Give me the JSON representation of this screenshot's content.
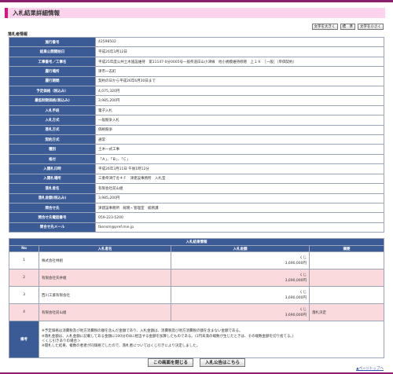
{
  "page": {
    "title": "入札結果詳細情報"
  },
  "font_buttons": {
    "large": "文字を大きく",
    "standard": "標　準",
    "small": "文字を小さく"
  },
  "section": {
    "label": "落札者情報"
  },
  "details": [
    {
      "label": "施行番号",
      "value": "42598502"
    },
    {
      "label": "結果公開開始日",
      "value": "平成26年3月12日"
    },
    {
      "label": "工事番号／工事名",
      "value": "平成25年度公共土木施設維持　第11147-0分0005号一般県道白山小津線　他小規模維持修繕　上１９　［一般］（単価契約）"
    },
    {
      "label": "履行場所",
      "value": "津市一志町"
    },
    {
      "label": "履行期間",
      "value": "契約の日から平成26年6月30日まで"
    },
    {
      "label": "予定価格（税込み）",
      "value": "4,075,320円"
    },
    {
      "label": "最低制限価格(税込み)",
      "value": "3,985,200円"
    },
    {
      "label": "入札手段",
      "value": "電子入札"
    },
    {
      "label": "入札方式",
      "value": "一般競争入札"
    },
    {
      "label": "落札方式",
      "value": "価格競争"
    },
    {
      "label": "契約方式",
      "value": "通常"
    },
    {
      "label": "種別",
      "value": "土木一式工事"
    },
    {
      "label": "格付",
      "value": "「Ａ」、「Ｂ」、「Ｃ」"
    },
    {
      "label": "入開札日時",
      "value": "平成26年3月11日 午後1時12分"
    },
    {
      "label": "入開札場所",
      "value": "三重県津庁舎４Ｆ　津建設事務所　入札室"
    },
    {
      "label": "落札者名",
      "value": "有限会社前山組"
    },
    {
      "label": "落札金額(税込み)",
      "value": "3,985,200円"
    },
    {
      "label": "問合せ先",
      "value": "津建設事務所　総務・管理室　総務課"
    },
    {
      "label": "問合せ先電話番号",
      "value": "059-223-5200"
    },
    {
      "label": "問合せ先メール",
      "value": "tkensm@pref.mie.jp"
    }
  ],
  "results": {
    "caption": "入札結果情報",
    "headers": {
      "no": "No",
      "name": "入札者名",
      "amount": "入札金額",
      "remarks": "摘要"
    },
    "rows": [
      {
        "no": "1",
        "name": "株式会社林組",
        "amount1": "くじ",
        "amount2": "3,690,000円",
        "remark": ""
      },
      {
        "no": "2",
        "name": "有限会社矢井組",
        "amount1": "くじ",
        "amount2": "3,690,000円",
        "remark": ""
      },
      {
        "no": "3",
        "name": "西川工業有限会社",
        "amount1": "くじ",
        "amount2": "3,690,000円",
        "remark": ""
      },
      {
        "no": "4",
        "name": "有限会社前山組",
        "amount1": "くじ",
        "amount2": "3,690,000円",
        "remark": "落札決定"
      }
    ],
    "remark_label": "備考",
    "remark_lines": [
      "※予定価格は消費税及び地方消費税の額を含んだ金額であり、入札金額は、消費税及び地方消費税の額を含まない金額である。",
      "※落札金額は、入札金額に記載してある金額に100分の8に相当する金額を加算したものである。(1円未満の端数が生じたときは、その端数金額を切り捨てる。)",
      "＜くじ引きありの場合＞",
      "※開札した結果、複数の者者が同価格でしたので、落札者についてはくじ引きにより決定しました。"
    ]
  },
  "footer": {
    "close": "この画面を閉じる",
    "notice": "入札公告はこちら",
    "page_top": "▲ページトップへ"
  }
}
